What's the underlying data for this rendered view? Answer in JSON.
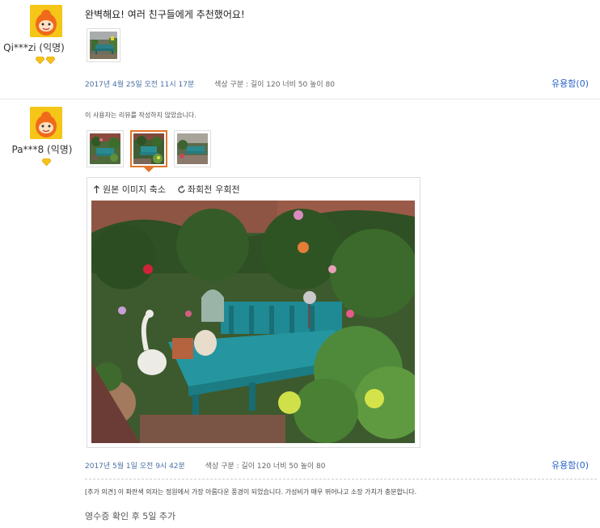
{
  "reviews": [
    {
      "user": "Qi***zi (익명)",
      "badge_count": 2,
      "text": "완벽해요! 여러 친구들에게 추천했어요!",
      "date": "2017년 4월 25일 오전 11시 17분",
      "option": "색상 구분 : 길이 120 너비 50 높이 80",
      "helpful": "유용함(0)"
    },
    {
      "user": "Pa***8 (익명)",
      "badge_count": 1,
      "text": "이 사용자는 리뷰를 작성하지 않았습니다.",
      "viewer": {
        "shrink_label": "원본 이미지 축소",
        "rotate_left_label": "좌회전",
        "rotate_right_label": "우회전"
      },
      "date": "2017년 5월 1일 오전 9시 42분",
      "option": "색상 구분 : 길이 120 너비 50 높이 80",
      "helpful": "유용함(0)",
      "extra_note": "[추가 의견] 이 파란색 의자는 정원에서 가장 아름다운 풍경이 되었습니다. 가성비가 매우 뛰어나고 소장 가치가 충분합니다.",
      "extra_time": "영수증 확인 후 5일 추가"
    }
  ],
  "colors": {
    "accent_orange": "#e2762a",
    "link_blue": "#2a62c9",
    "avatar_yellow": "#f5c518",
    "gem_yellow": "#f7c31b"
  },
  "icons": [
    "mascot-avatar",
    "gem-badge-icon",
    "up-arrow-icon",
    "rotate-icon"
  ]
}
